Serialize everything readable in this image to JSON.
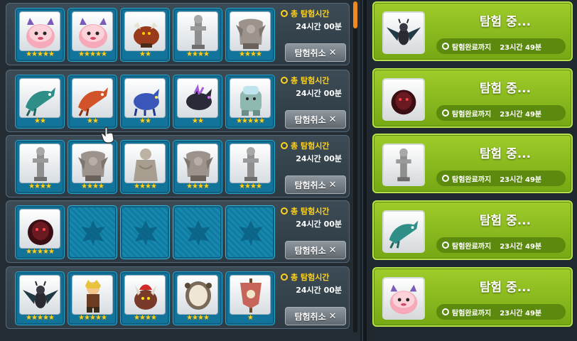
{
  "expedition_teams": [
    {
      "slots": [
        {
          "icon": "pink-blob-monster-icon",
          "stars": "★★★★★"
        },
        {
          "icon": "pink-blob-monster-icon",
          "stars": "★★★★★"
        },
        {
          "icon": "red-bull-monster-icon",
          "stars": "★★"
        },
        {
          "icon": "stone-statue-icon",
          "stars": "★★★★"
        },
        {
          "icon": "stone-gargoyle-icon",
          "stars": "★★★★"
        }
      ],
      "title": "총 탐험시간",
      "duration": "24시간 00분",
      "cancel_label": "탐험취소"
    },
    {
      "slots": [
        {
          "icon": "teal-dragon-icon",
          "stars": "★★"
        },
        {
          "icon": "red-dragon-icon",
          "stars": "★★"
        },
        {
          "icon": "blue-wolf-icon",
          "stars": "★★"
        },
        {
          "icon": "dark-wolf-icon",
          "stars": "★★"
        },
        {
          "icon": "ice-golem-icon",
          "stars": "★★★★★"
        }
      ],
      "title": "총 탐험시간",
      "duration": "24시간 00분",
      "cancel_label": "탐험취소"
    },
    {
      "slots": [
        {
          "icon": "stone-statue-icon",
          "stars": "★★★★"
        },
        {
          "icon": "stone-gargoyle-icon",
          "stars": "★★★★"
        },
        {
          "icon": "stone-goddess-icon",
          "stars": "★★★★"
        },
        {
          "icon": "stone-gargoyle-icon",
          "stars": "★★★★"
        },
        {
          "icon": "stone-statue-icon",
          "stars": "★★★★"
        }
      ],
      "title": "총 탐험시간",
      "duration": "24시간 00분",
      "cancel_label": "탐험취소"
    },
    {
      "slots": [
        {
          "icon": "dark-shadow-monster-icon",
          "stars": "★★★★★"
        },
        {
          "icon": "empty-slot-leaf-icon",
          "stars": ""
        },
        {
          "icon": "empty-slot-leaf-icon",
          "stars": ""
        },
        {
          "icon": "empty-slot-leaf-icon",
          "stars": ""
        },
        {
          "icon": "empty-slot-leaf-icon",
          "stars": ""
        }
      ],
      "title": "총 탐험시간",
      "duration": "24시간 00분",
      "cancel_label": "탐험취소"
    },
    {
      "slots": [
        {
          "icon": "dark-winged-demon-icon",
          "stars": "★★★★★"
        },
        {
          "icon": "blonde-warrior-icon",
          "stars": "★★★★★"
        },
        {
          "icon": "red-horned-beast-icon",
          "stars": "★★★★"
        },
        {
          "icon": "stone-mirror-icon",
          "stars": "★★★★"
        },
        {
          "icon": "banner-totem-icon",
          "stars": "★"
        }
      ],
      "title": "총 탐험시간",
      "duration": "24시간 00분",
      "cancel_label": "탐험취소"
    }
  ],
  "status_cards": [
    {
      "icon": "dark-winged-demon-icon",
      "title": "탐험 중...",
      "timer_label": "탐험완료까지",
      "remaining": "23시간 49분"
    },
    {
      "icon": "dark-shadow-monster-icon",
      "title": "탐험 중...",
      "timer_label": "탐험완료까지",
      "remaining": "23시간 49분"
    },
    {
      "icon": "stone-statue-icon",
      "title": "탐험 중...",
      "timer_label": "탐험완료까지",
      "remaining": "23시간 49분"
    },
    {
      "icon": "teal-dragon-icon",
      "title": "탐험 중...",
      "timer_label": "탐험완료까지",
      "remaining": "23시간 49분"
    },
    {
      "icon": "pink-blob-monster-icon",
      "title": "탐험 중...",
      "timer_label": "탐험완료까지",
      "remaining": "23시간 49분"
    }
  ],
  "colors": {
    "slot_blue": "#12749a",
    "star_gold": "#ffd21a",
    "card_green": "#8fbf20",
    "scroll_orange": "#f08a1c"
  }
}
